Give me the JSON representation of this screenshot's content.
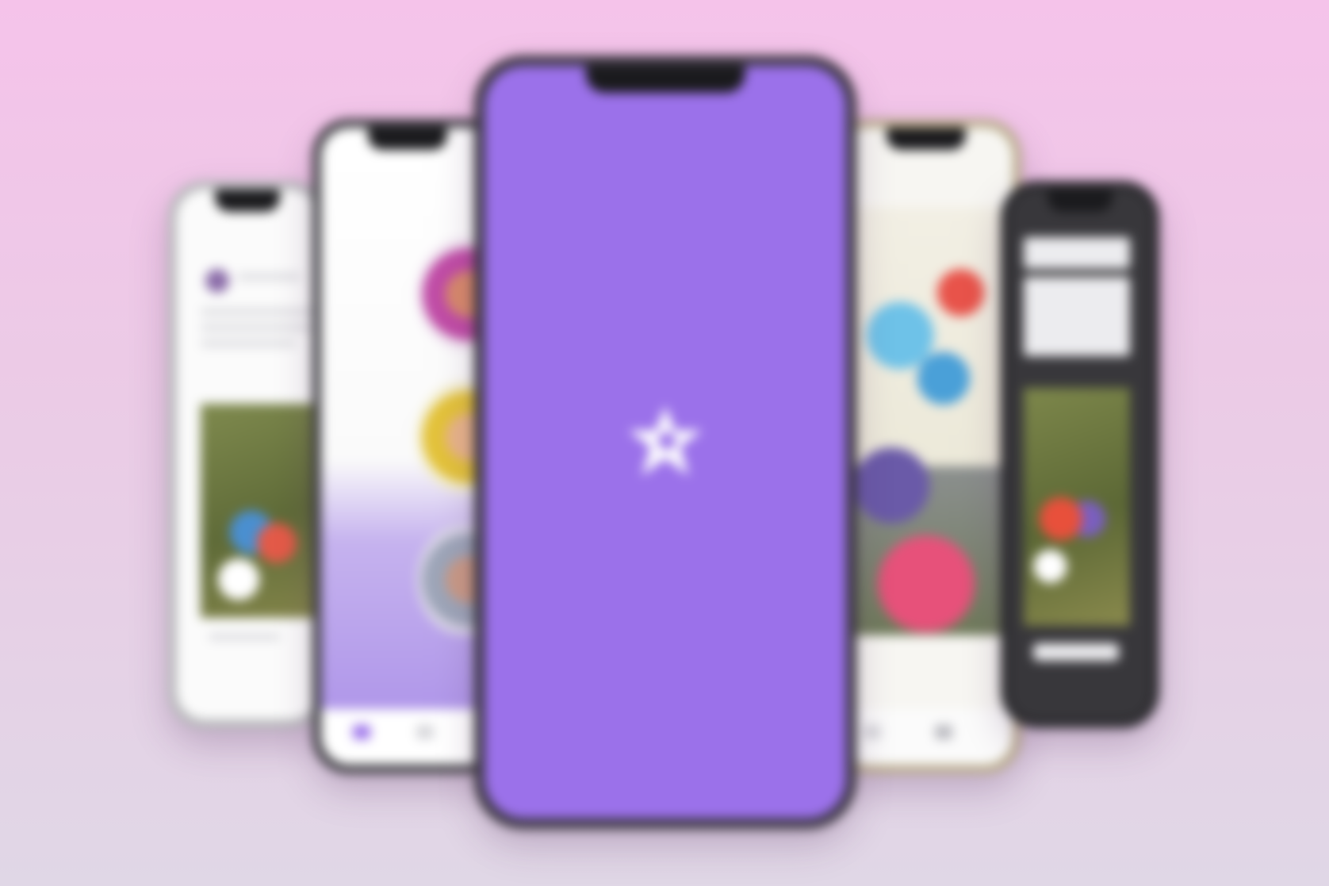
{
  "scene": {
    "background_top": "#f5c3ea",
    "background_bottom": "#e0d7e6",
    "accent": "#9b71ea"
  },
  "phones": [
    {
      "position": "far-left",
      "screen": "feed-post",
      "frame": "silver"
    },
    {
      "position": "left",
      "screen": "profile-circles",
      "frame": "graphite"
    },
    {
      "position": "center",
      "screen": "splash",
      "frame": "dark",
      "logo_icon": "star-logo-icon"
    },
    {
      "position": "right",
      "screen": "photo-collage",
      "frame": "gold"
    },
    {
      "position": "far-right",
      "screen": "dark-post",
      "frame": "dark"
    }
  ]
}
